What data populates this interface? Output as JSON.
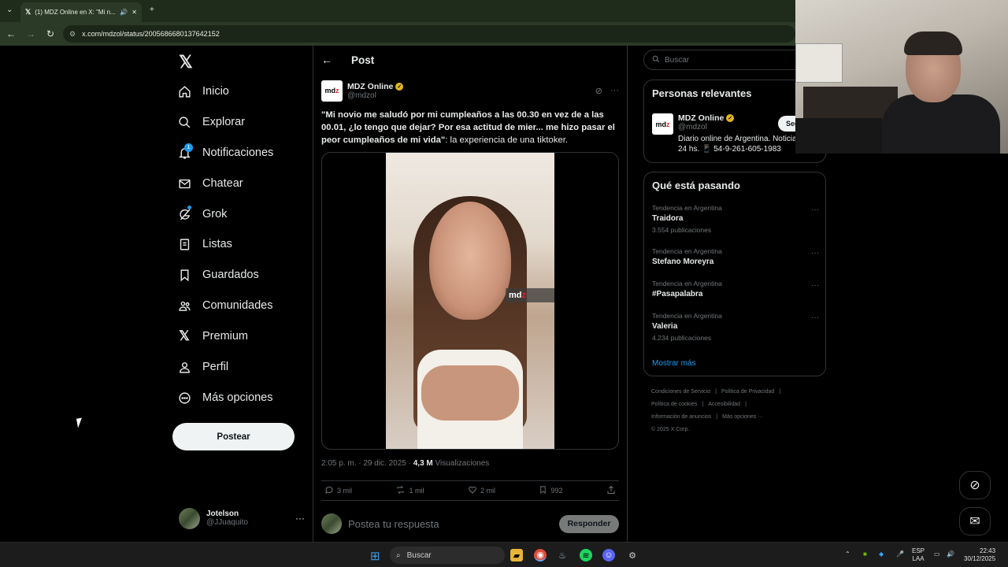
{
  "browser": {
    "tab_title": "(1) MDZ Online en X: \"Mi n...",
    "url": "x.com/mdzol/status/2005686680137642152"
  },
  "nav": {
    "items": [
      {
        "label": "Inicio",
        "icon": "home-icon"
      },
      {
        "label": "Explorar",
        "icon": "search-icon"
      },
      {
        "label": "Notificaciones",
        "icon": "bell-icon",
        "badge": "1"
      },
      {
        "label": "Chatear",
        "icon": "mail-icon"
      },
      {
        "label": "Grok",
        "icon": "grok-icon"
      },
      {
        "label": "Listas",
        "icon": "list-icon"
      },
      {
        "label": "Guardados",
        "icon": "bookmark-icon"
      },
      {
        "label": "Comunidades",
        "icon": "people-icon"
      },
      {
        "label": "Premium",
        "icon": "x-icon"
      },
      {
        "label": "Perfil",
        "icon": "user-icon"
      },
      {
        "label": "Más opciones",
        "icon": "more-circle-icon"
      }
    ],
    "post_button": "Postear",
    "account": {
      "name": "Jotelson",
      "handle": "@JJuaquito"
    }
  },
  "post": {
    "header": "Post",
    "author_name": "MDZ Online",
    "author_handle": "@mdzol",
    "text_bold": "\"Mi novio me saludó por mi cumpleaños a las 00.30 en vez de a las 00.01, ¿lo tengo que dejar? Por esa actitud de mier... me hizo pasar el peor cumpleaños de mi vida\"",
    "text_rest": ": la experiencia de una tiktoker.",
    "watermark": "mdz",
    "time": "2:05 p. m. · 29 dic. 2025 · ",
    "views_count": "4,3 M",
    "views_label": " Visualizaciones",
    "replies": "3 mil",
    "reposts": "1 mil",
    "likes": "2 mil",
    "bookmarks": "992",
    "reply_placeholder": "Postea tu respuesta",
    "reply_button": "Responder"
  },
  "sidebar": {
    "search_placeholder": "Buscar",
    "relevant_title": "Personas relevantes",
    "relevant": {
      "name": "MDZ Online",
      "handle": "@mdzol",
      "bio": "Diario online de Argentina. Noticias las 24 hs. 📱 54-9-261-605-1983",
      "follow": "Seguir"
    },
    "trends_title": "Qué está pasando",
    "trends": [
      {
        "category": "Tendencia en Argentina",
        "name": "Traidora",
        "count": "3.554 publicaciones"
      },
      {
        "category": "Tendencia en Argentina",
        "name": "Stefano Moreyra",
        "count": ""
      },
      {
        "category": "Tendencia en Argentina",
        "name": "#Pasapalabra",
        "count": ""
      },
      {
        "category": "Tendencia en Argentina",
        "name": "Valeria",
        "count": "4.234 publicaciones"
      }
    ],
    "show_more": "Mostrar más",
    "footer": [
      "Condiciones de Servicio",
      "|",
      "Política de Privacidad",
      "|",
      "Política de cookies",
      "|",
      "Accesibilidad",
      "|",
      "Información de anuncios",
      "|",
      "Más opciones ···",
      "© 2025 X Corp."
    ]
  },
  "taskbar": {
    "search": "Buscar",
    "lang_top": "ESP",
    "lang_bottom": "LAA",
    "time": "22:43",
    "date": "30/12/2025"
  },
  "colors": {
    "accent": "#1d9bf0",
    "chrome": "#2b3a26",
    "background": "#000000",
    "verified": "#e2b719"
  }
}
